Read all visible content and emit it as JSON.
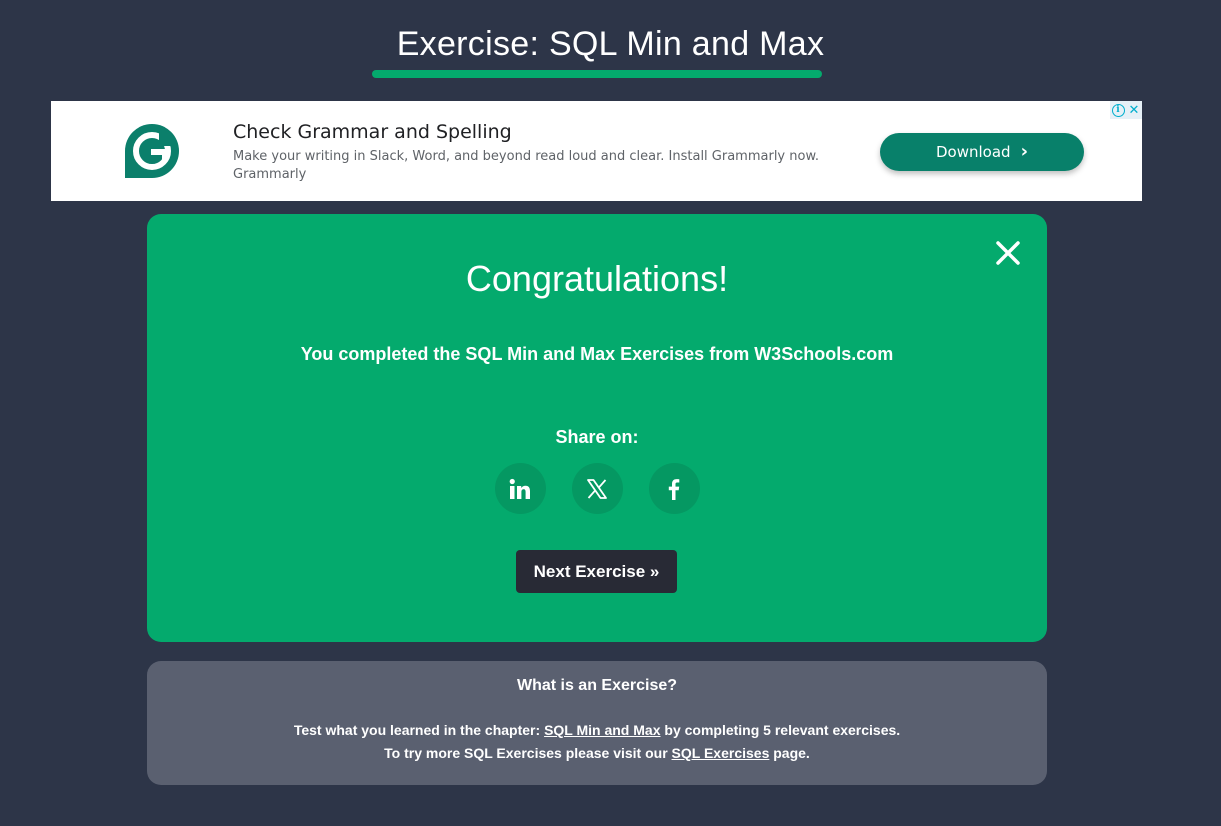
{
  "header": {
    "title": "Exercise: SQL Min and Max"
  },
  "ad": {
    "headline": "Check Grammar and Spelling",
    "body": "Make your writing in Slack, Word, and beyond read loud and clear. Install Grammarly now.",
    "advertiser": "Grammarly",
    "cta_label": "Download",
    "logo_icon": "grammarly-g-icon",
    "choices_icons": [
      "info-icon",
      "close-icon"
    ],
    "brand_color": "#15c39a"
  },
  "congrats": {
    "title": "Congratulations!",
    "message": "You completed the SQL Min and Max Exercises from W3Schools.com",
    "share_label": "Share on:",
    "share_buttons": [
      {
        "name": "linkedin",
        "icon": "linkedin-icon"
      },
      {
        "name": "x",
        "icon": "x-icon"
      },
      {
        "name": "facebook",
        "icon": "facebook-icon"
      }
    ],
    "next_label": "Next Exercise »",
    "close_icon": "close-icon"
  },
  "info": {
    "heading": "What is an Exercise?",
    "line1_prefix": "Test what you learned in the chapter: ",
    "line1_link": "SQL Min and Max",
    "line1_suffix": " by completing 5 relevant exercises.",
    "line2_prefix": "To try more SQL Exercises please visit our ",
    "line2_link": "SQL Exercises",
    "line2_suffix": " page."
  },
  "colors": {
    "background": "#2d3548",
    "accent_green": "#04aa6d",
    "share_circle": "#059862",
    "next_button": "#282a35",
    "info_panel": "#5a6070",
    "ad_cta": "#08806a"
  }
}
